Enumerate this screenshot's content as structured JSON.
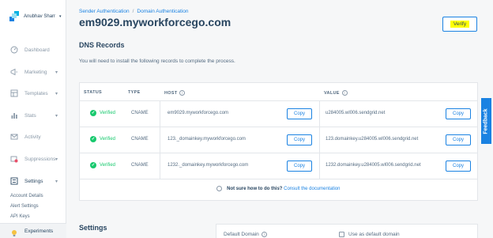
{
  "account": {
    "name": "Anubhav Sharr",
    "caret": "▾"
  },
  "nav": {
    "items": [
      {
        "label": "Dashboard",
        "icon": "gauge-icon",
        "has_chevron": false
      },
      {
        "label": "Marketing",
        "icon": "megaphone-icon",
        "has_chevron": true
      },
      {
        "label": "Templates",
        "icon": "templates-icon",
        "has_chevron": true
      },
      {
        "label": "Stats",
        "icon": "bar-chart-icon",
        "has_chevron": true
      },
      {
        "label": "Activity",
        "icon": "envelope-icon",
        "has_chevron": false
      },
      {
        "label": "Suppressions",
        "icon": "suppression-icon",
        "has_chevron": true
      },
      {
        "label": "Settings",
        "icon": "settings-icon",
        "has_chevron": true
      }
    ],
    "chevron": "▾",
    "settings_subitems": [
      "Account Details",
      "Alert Settings",
      "API Keys"
    ],
    "experiments": {
      "label": "Experiments",
      "icon": "lightbulb-icon"
    }
  },
  "breadcrumb": {
    "first": "Sender Authentication",
    "separator": "/",
    "second": "Domain Authentication"
  },
  "page_title": "em9029.myworkforcego.com",
  "verify_label": "Verify",
  "dns": {
    "title": "DNS Records",
    "instructions": "You will need to install the following records to complete the process.",
    "headers": {
      "status": "STATUS",
      "type": "TYPE",
      "host": "HOST",
      "value": "VALUE"
    },
    "rows": [
      {
        "status": "Verified",
        "type": "CNAME",
        "host": "em9029.myworkforcego.com",
        "value": "u284005.wl006.sendgrid.net",
        "copy1": "Copy",
        "copy2": "Copy"
      },
      {
        "status": "Verified",
        "type": "CNAME",
        "host": "123._domainkey.myworkforcego.com",
        "value": "123.domainkey.u284005.wl006.sendgrid.net",
        "copy1": "Copy",
        "copy2": "Copy"
      },
      {
        "status": "Verified",
        "type": "CNAME",
        "host": "1232._domainkey.myworkforcego.com",
        "value": "1232.domainkey.u284005.wl006.sendgrid.net",
        "copy1": "Copy",
        "copy2": "Copy"
      }
    ],
    "help": {
      "lead": "Not sure how to do this?",
      "link": "Consult the documentation"
    }
  },
  "settings": {
    "title": "Settings",
    "default_domain_label": "Default Domain",
    "use_default_label": "Use as default domain"
  },
  "feedback_label": "Feedback",
  "colors": {
    "accent": "#1a82e2",
    "verified": "#18c96e",
    "text": "#294661",
    "highlight": "#ffff00"
  }
}
